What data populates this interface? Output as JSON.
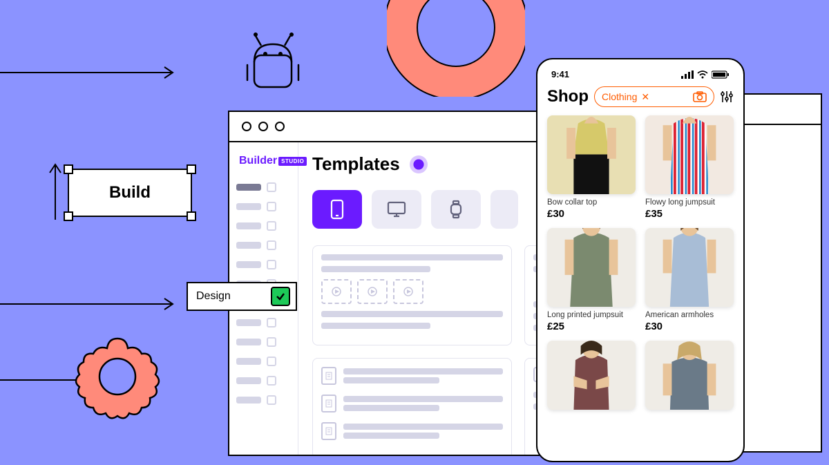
{
  "decor": {
    "build_label": "Build",
    "design_label": "Design"
  },
  "window": {
    "logo_text": "Builder",
    "logo_badge": "STUDIO",
    "title": "Templates"
  },
  "phone": {
    "time": "9:41",
    "title": "Shop",
    "chip_label": "Clothing",
    "products": [
      {
        "name": "Bow collar top",
        "price": "£30",
        "bg": "#e8dfb3",
        "garment": "#111"
      },
      {
        "name": "Flowy long jumpsuit",
        "price": "£35",
        "bg": "#f2e9e1",
        "garment": "#d9d9d9"
      },
      {
        "name": "Long printed jumpsuit",
        "price": "£25",
        "bg": "#efece6",
        "garment": "#7b8a6f"
      },
      {
        "name": "American armholes",
        "price": "£30",
        "bg": "#efece6",
        "garment": "#a8bdd6"
      },
      {
        "name": "",
        "price": "",
        "bg": "#efece6",
        "garment": "#7a4848"
      },
      {
        "name": "",
        "price": "",
        "bg": "#efece6",
        "garment": "#6a7a88"
      }
    ]
  },
  "colors": {
    "accent": "#6b1bff",
    "coral": "#ff8a7a",
    "green": "#1dc958"
  }
}
